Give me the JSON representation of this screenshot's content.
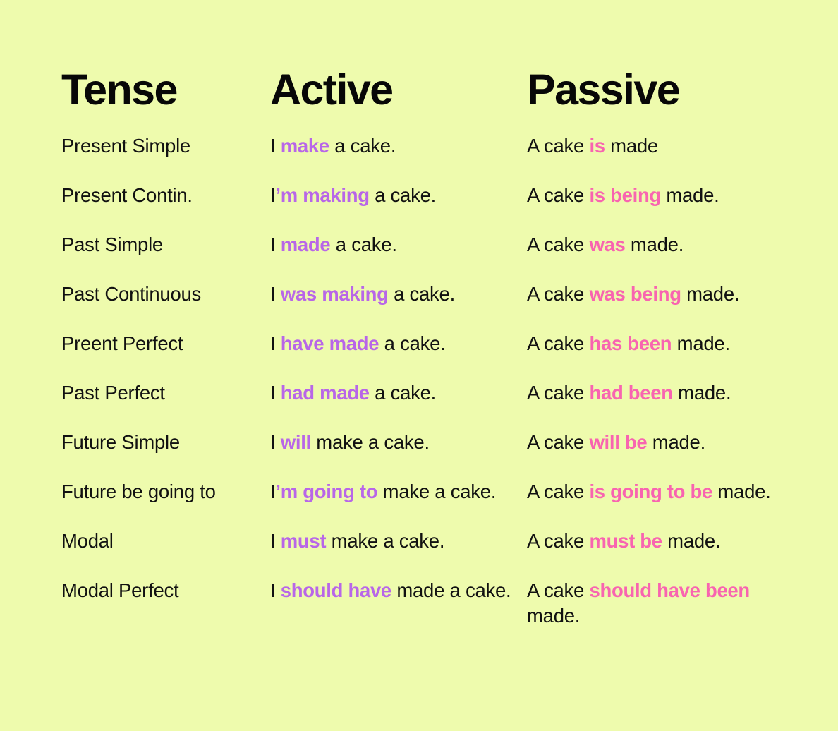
{
  "page": {
    "background_color": "#eefbad",
    "text_color": "#111111",
    "active_accent_color": "#b866e8",
    "passive_accent_color": "#f864b0"
  },
  "headers": {
    "tense": "Tense",
    "active": "Active",
    "passive": "Passive"
  },
  "rows": [
    {
      "tense": "Present Simple",
      "active": {
        "pre": "I ",
        "hl": "make",
        "post": " a cake."
      },
      "passive": {
        "pre": "A cake ",
        "hl": "is",
        "post": " made"
      }
    },
    {
      "tense": "Present Contin.",
      "active": {
        "pre": "I",
        "hl": "’m making",
        "post": " a cake."
      },
      "passive": {
        "pre": "A cake ",
        "hl": "is being",
        "post": " made."
      }
    },
    {
      "tense": "Past Simple",
      "active": {
        "pre": "I ",
        "hl": "made",
        "post": " a cake."
      },
      "passive": {
        "pre": "A cake ",
        "hl": "was",
        "post": " made."
      }
    },
    {
      "tense": "Past Continuous",
      "active": {
        "pre": "I ",
        "hl": "was making",
        "post": " a cake."
      },
      "passive": {
        "pre": "A cake ",
        "hl": "was being",
        "post": " made."
      }
    },
    {
      "tense": "Preent Perfect",
      "active": {
        "pre": "I ",
        "hl": "have made",
        "post": " a cake."
      },
      "passive": {
        "pre": "A cake ",
        "hl": "has been",
        "post": " made."
      }
    },
    {
      "tense": "Past Perfect",
      "active": {
        "pre": "I ",
        "hl": "had made",
        "post": " a cake."
      },
      "passive": {
        "pre": "A cake ",
        "hl": "had been",
        "post": " made."
      }
    },
    {
      "tense": "Future Simple",
      "active": {
        "pre": "I ",
        "hl": "will",
        "post": " make a cake."
      },
      "passive": {
        "pre": "A cake ",
        "hl": "will be",
        "post": " made."
      }
    },
    {
      "tense": "Future be going to",
      "active": {
        "pre": "I",
        "hl": "’m going to",
        "post": " make a cake."
      },
      "passive": {
        "pre": "A cake ",
        "hl": "is going to be",
        "post": " made."
      }
    },
    {
      "tense": "Modal",
      "active": {
        "pre": "I ",
        "hl": "must",
        "post": " make a cake."
      },
      "passive": {
        "pre": "A cake ",
        "hl": "must be",
        "post": " made."
      }
    },
    {
      "tense": "Modal Perfect",
      "active": {
        "pre": "I ",
        "hl": "should have",
        "post": " made a cake."
      },
      "passive": {
        "pre": "A cake ",
        "hl": "should have been",
        "post": " made."
      }
    }
  ]
}
